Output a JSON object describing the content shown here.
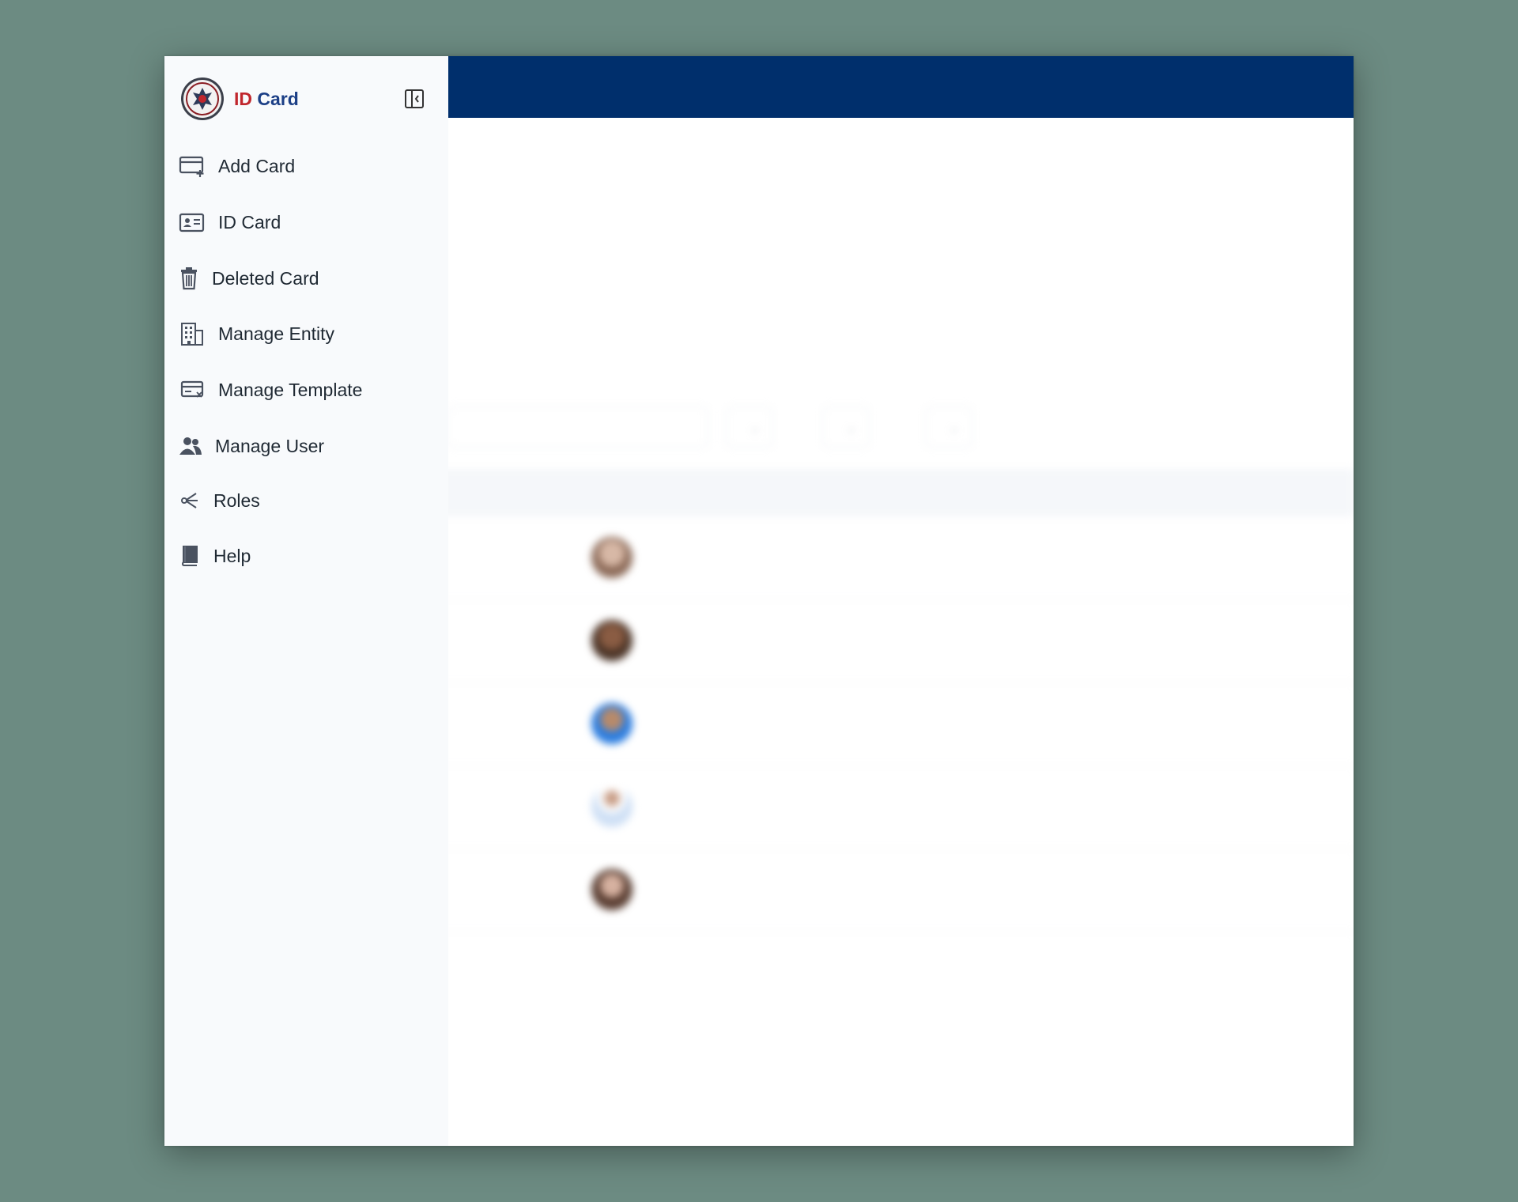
{
  "brand": {
    "title_part1": "ID",
    "title_part2": "Card"
  },
  "sidebar": {
    "items": [
      {
        "label": "Add Card",
        "icon": "add-card-icon"
      },
      {
        "label": "ID Card",
        "icon": "id-card-icon"
      },
      {
        "label": "Deleted Card",
        "icon": "trash-icon"
      },
      {
        "label": "Manage Entity",
        "icon": "building-icon"
      },
      {
        "label": "Manage Template",
        "icon": "template-icon"
      },
      {
        "label": "Manage User",
        "icon": "users-icon"
      },
      {
        "label": "Roles",
        "icon": "roles-icon"
      },
      {
        "label": "Help",
        "icon": "book-icon"
      }
    ]
  },
  "colors": {
    "topbar": "#002f6c",
    "brand_red": "#c0262d",
    "brand_blue": "#1c3f86",
    "backdrop": "#6c8b82"
  }
}
